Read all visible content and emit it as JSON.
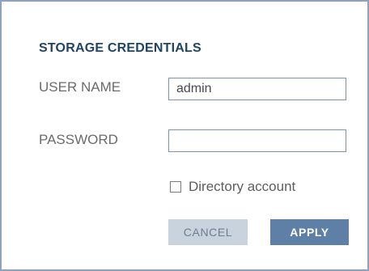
{
  "dialog": {
    "title": "STORAGE CREDENTIALS",
    "username": {
      "label": "USER NAME",
      "value": "admin",
      "placeholder": ""
    },
    "password": {
      "label": "PASSWORD",
      "value": "",
      "placeholder": ""
    },
    "directory_account": {
      "label": "Directory account",
      "checked": false
    },
    "buttons": {
      "cancel_label": "CANCEL",
      "apply_label": "APPLY"
    }
  },
  "colors": {
    "border": "#8ea2bd",
    "title": "#1f4466",
    "apply_bg": "#5e7fa6",
    "cancel_bg": "#c9d3de"
  }
}
